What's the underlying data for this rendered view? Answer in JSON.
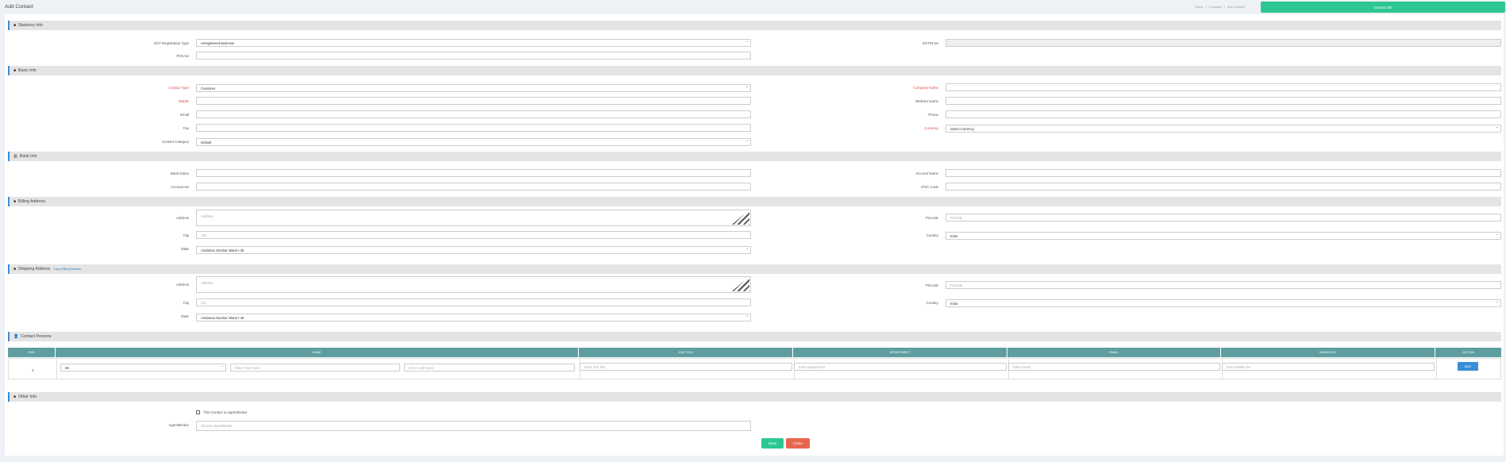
{
  "header": {
    "title": "Add Contact",
    "breadcrumb": [
      "Home",
      "/",
      "Contacts",
      "/",
      "Add Contact"
    ],
    "contact_list_label": "Contact list"
  },
  "statutory": {
    "title": "Statutory Info",
    "gst_type_label": "GST Registration Type",
    "gst_type_value": "Unregistered Business",
    "gstin_label": "GSTIN No",
    "pan_label": "PAN No"
  },
  "basic": {
    "title": "Basic Info",
    "contact_type_label": "Contact Type",
    "contact_type_value": "Customer",
    "company_label": "Company Name",
    "mobile_label": "Mobile",
    "website_label": "Website Name",
    "email_label": "Email",
    "phone_label": "Phone",
    "fax_label": "Fax",
    "currency_label": "Currency",
    "currency_value": "Select Currency",
    "category_label": "Contact Category",
    "category_value": "Default"
  },
  "bank": {
    "title": "Bank Info",
    "bank_name_label": "Bank Name",
    "account_name_label": "Account Name",
    "account_no_label": "Account No",
    "ifsc_label": "IFSC Code"
  },
  "billing": {
    "title": "Billing Address",
    "address_label": "Address",
    "address_placeholder": "Address",
    "pincode_label": "Pincode",
    "pincode_placeholder": "Pincode",
    "city_label": "City",
    "city_placeholder": "City",
    "country_label": "Country",
    "country_value": "India",
    "state_label": "State",
    "state_value": "Andaman Nicobar Island • 35"
  },
  "shipping": {
    "title": "Shipping Address",
    "copy_link": "Copy Billing Address",
    "address_label": "Address",
    "address_placeholder": "Address",
    "pincode_label": "Pincode",
    "pincode_placeholder": "Pincode",
    "city_label": "City",
    "city_placeholder": "City",
    "country_label": "Country",
    "country_value": "India",
    "state_label": "State",
    "state_value": "Andaman Nicobar Island • 35"
  },
  "contacts": {
    "title": "Contact Persons",
    "columns": [
      "SNO",
      "NAME",
      "JOB TITLE",
      "DEPARTMENT",
      "EMAIL",
      "MOBILE NO",
      "ACTION"
    ],
    "row": {
      "sno": "1",
      "salutation": "Mr.",
      "first_placeholder": "Enter First Name",
      "last_placeholder": "Enter Last Name",
      "job_placeholder": "Enter Job Title",
      "dept_placeholder": "Enter Department",
      "email_placeholder": "Enter Email",
      "mobile_placeholder": "Enter Mobile No",
      "add_label": "ADD"
    }
  },
  "other": {
    "title": "Other Info",
    "agent_check_label": "This Contact is Agent/Broker",
    "agent_label": "Agent/Broker",
    "agent_placeholder": "Choose Agent/Broker"
  },
  "actions": {
    "save": "Save",
    "close": "Close"
  }
}
